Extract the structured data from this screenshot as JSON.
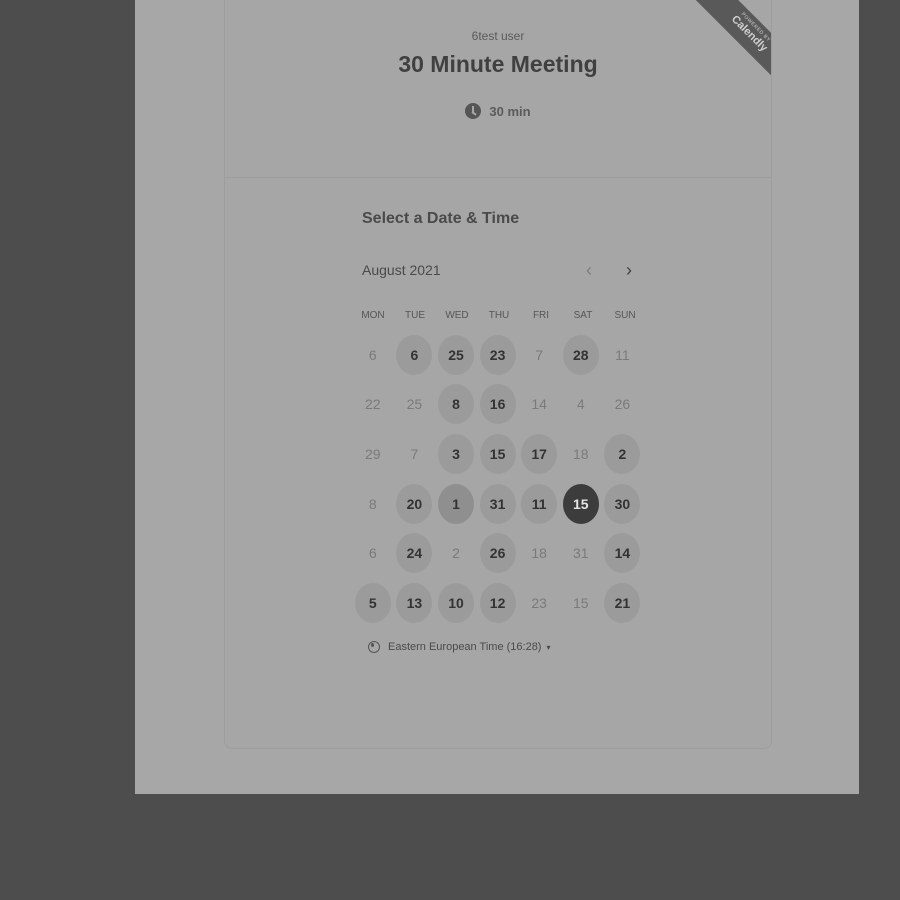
{
  "event": {
    "owner": "6test user",
    "title": "30 Minute Meeting",
    "duration": "30 min",
    "icon": "clock-icon"
  },
  "ribbon": {
    "small": "POWERED BY",
    "brand": "Calendly"
  },
  "calendar": {
    "section_title": "Select a Date & Time",
    "month_label": "August 2021",
    "prev_icon": "chevron-left-icon",
    "next_icon": "chevron-right-icon",
    "weekdays": [
      "MON",
      "TUE",
      "WED",
      "THU",
      "FRI",
      "SAT",
      "SUN"
    ],
    "weeks": [
      [
        {
          "d": "6",
          "s": "off"
        },
        {
          "d": "6",
          "s": "avail"
        },
        {
          "d": "25",
          "s": "avail"
        },
        {
          "d": "23",
          "s": "avail"
        },
        {
          "d": "7",
          "s": "off"
        },
        {
          "d": "28",
          "s": "avail"
        },
        {
          "d": "11",
          "s": "off"
        }
      ],
      [
        {
          "d": "22",
          "s": "off"
        },
        {
          "d": "25",
          "s": "off"
        },
        {
          "d": "8",
          "s": "avail"
        },
        {
          "d": "16",
          "s": "avail"
        },
        {
          "d": "14",
          "s": "off"
        },
        {
          "d": "4",
          "s": "off"
        },
        {
          "d": "26",
          "s": "off"
        }
      ],
      [
        {
          "d": "29",
          "s": "off"
        },
        {
          "d": "7",
          "s": "off"
        },
        {
          "d": "3",
          "s": "avail"
        },
        {
          "d": "15",
          "s": "avail"
        },
        {
          "d": "17",
          "s": "avail"
        },
        {
          "d": "18",
          "s": "off"
        },
        {
          "d": "2",
          "s": "avail"
        }
      ],
      [
        {
          "d": "8",
          "s": "off"
        },
        {
          "d": "20",
          "s": "avail"
        },
        {
          "d": "1",
          "s": "avail-strong"
        },
        {
          "d": "31",
          "s": "avail"
        },
        {
          "d": "11",
          "s": "avail"
        },
        {
          "d": "15",
          "s": "selected"
        },
        {
          "d": "30",
          "s": "avail"
        }
      ],
      [
        {
          "d": "6",
          "s": "off"
        },
        {
          "d": "24",
          "s": "avail"
        },
        {
          "d": "2",
          "s": "off"
        },
        {
          "d": "26",
          "s": "avail"
        },
        {
          "d": "18",
          "s": "off"
        },
        {
          "d": "31",
          "s": "off"
        },
        {
          "d": "14",
          "s": "avail"
        }
      ],
      [
        {
          "d": "5",
          "s": "avail"
        },
        {
          "d": "13",
          "s": "avail"
        },
        {
          "d": "10",
          "s": "avail"
        },
        {
          "d": "12",
          "s": "avail"
        },
        {
          "d": "23",
          "s": "off"
        },
        {
          "d": "15",
          "s": "off"
        },
        {
          "d": "21",
          "s": "avail"
        }
      ]
    ]
  },
  "timezone": {
    "label": "Eastern European Time (16:28)",
    "icon": "globe-icon",
    "caret": "▾"
  }
}
